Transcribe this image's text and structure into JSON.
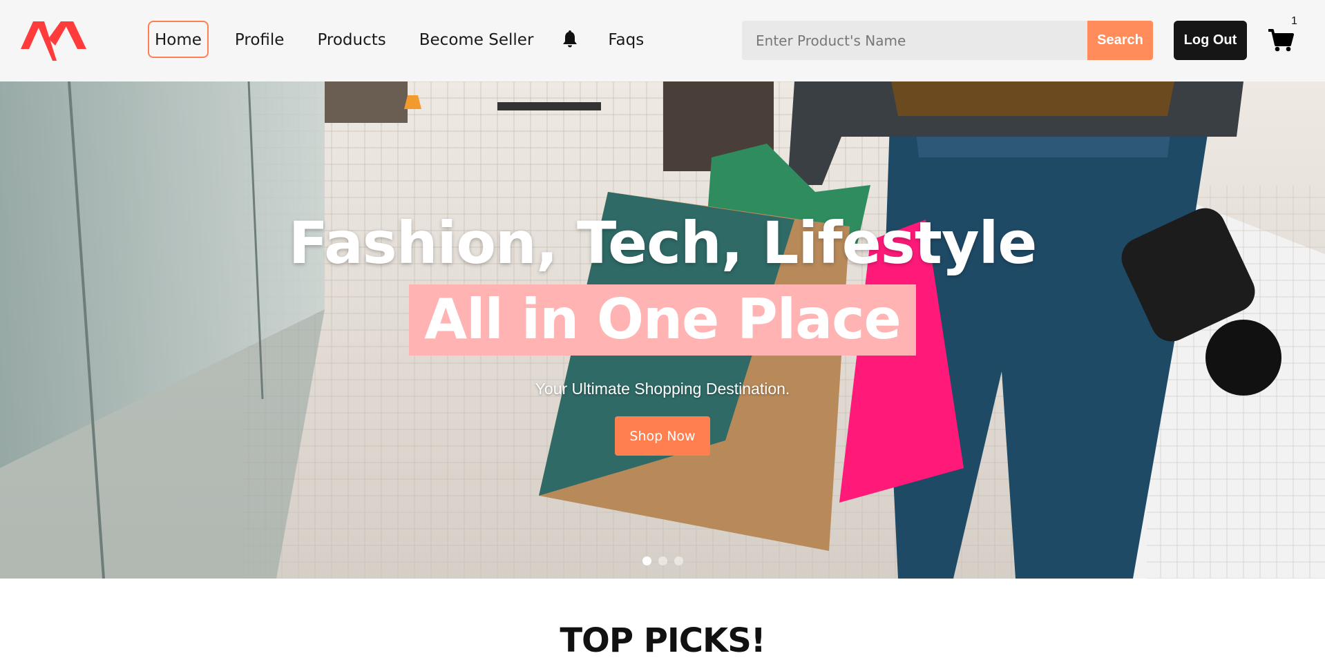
{
  "brand": {
    "logo_icon": "brand-logo-icon",
    "accent_color": "#ff3b3b"
  },
  "nav": {
    "items": [
      {
        "label": "Home",
        "active": true
      },
      {
        "label": "Profile",
        "active": false
      },
      {
        "label": "Products",
        "active": false
      },
      {
        "label": "Become Seller",
        "active": false
      },
      {
        "label": "Faqs",
        "active": false
      }
    ],
    "notification_icon": "bell-icon"
  },
  "search": {
    "placeholder": "Enter Product's Name",
    "value": "",
    "button_label": "Search",
    "button_color": "#ff8c5a"
  },
  "auth": {
    "logout_label": "Log Out"
  },
  "cart": {
    "icon": "cart-icon",
    "count": "1"
  },
  "hero": {
    "title": "Fashion, Tech, Lifestyle",
    "subtitle": "All in One Place",
    "highlight_color": "#ffb3b3",
    "tagline": "Your Ultimate Shopping Destination.",
    "cta_label": "Shop Now",
    "cta_color": "#ff7f50",
    "slides": {
      "count": 3,
      "active_index": 0
    }
  },
  "sections": {
    "top_picks_title": "TOP PICKS!"
  }
}
